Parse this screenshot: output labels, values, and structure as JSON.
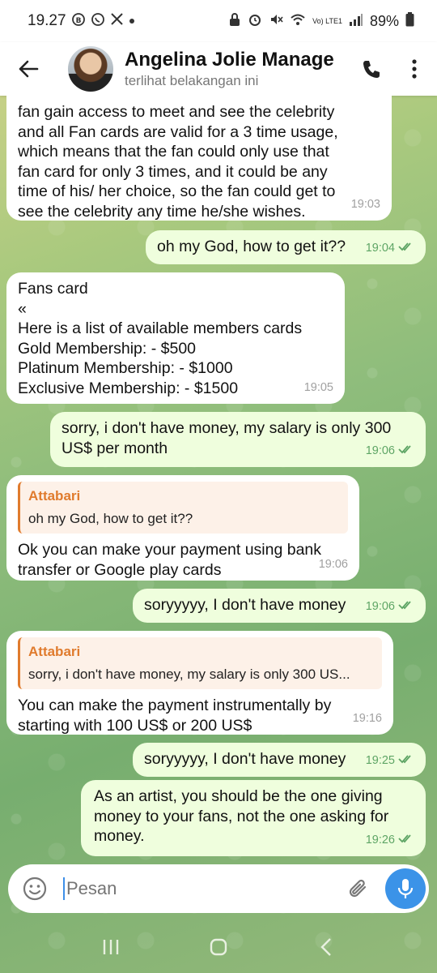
{
  "status_bar": {
    "time": "19.27",
    "icons": [
      "whatsapp-business-icon",
      "whatsapp-icon",
      "x-icon"
    ],
    "battery": "89%",
    "network_label": "Vo) LTE1"
  },
  "header": {
    "title": "Angelina Jolie Managem",
    "subtitle": "terlihat belakangan ini"
  },
  "messages": [
    {
      "direction": "in",
      "text": "fan gain access to meet and see the celebrity\nand all Fan cards are valid for a 3 time usage,\nwhich means that the fan could only use that\nfan card for only 3 times, and it could be any\ntime of his/ her choice, so the fan could get to\nsee the celebrity any time he/she wishes.",
      "time": "19:03"
    },
    {
      "direction": "out",
      "text": "oh my God, how to get it??",
      "time": "19:04"
    },
    {
      "direction": "in",
      "text": "Fans card\n«\nHere is a list of available members cards\nGold Membership: - $500\nPlatinum Membership: - $1000\nExclusive Membership: - $1500",
      "time": "19:05"
    },
    {
      "direction": "out",
      "text": "sorry, i don't have money, my salary is only 300\nUS$ per month",
      "time": "19:06"
    },
    {
      "direction": "in",
      "reply_name": "Attabari",
      "reply_text": "oh my God, how to get it??",
      "text": "Ok you can make your payment using bank\ntransfer or Google play cards",
      "time": "19:06"
    },
    {
      "direction": "out",
      "text": "soryyyyy, I don't have money",
      "time": "19:06"
    },
    {
      "direction": "in",
      "reply_name": "Attabari",
      "reply_text": "sorry, i don't have money, my salary is only 300 US...",
      "text": "You can make the payment instrumentally by\nstarting with 100 US$ or 200 US$",
      "time": "19:16"
    },
    {
      "direction": "out",
      "text": "soryyyyy, I don't have money",
      "time": "19:25"
    },
    {
      "direction": "out",
      "text": "As an artist, you should be the one giving\nmoney to your fans, not the one asking for\nmoney.",
      "time": "19:26"
    }
  ],
  "composer": {
    "placeholder": "Pesan"
  },
  "colors": {
    "incoming_bubble": "#ffffff",
    "outgoing_bubble": "#effedd",
    "read_check": "#5ea565",
    "reply_accent": "#e07b2d",
    "mic_button": "#3b93e8"
  }
}
